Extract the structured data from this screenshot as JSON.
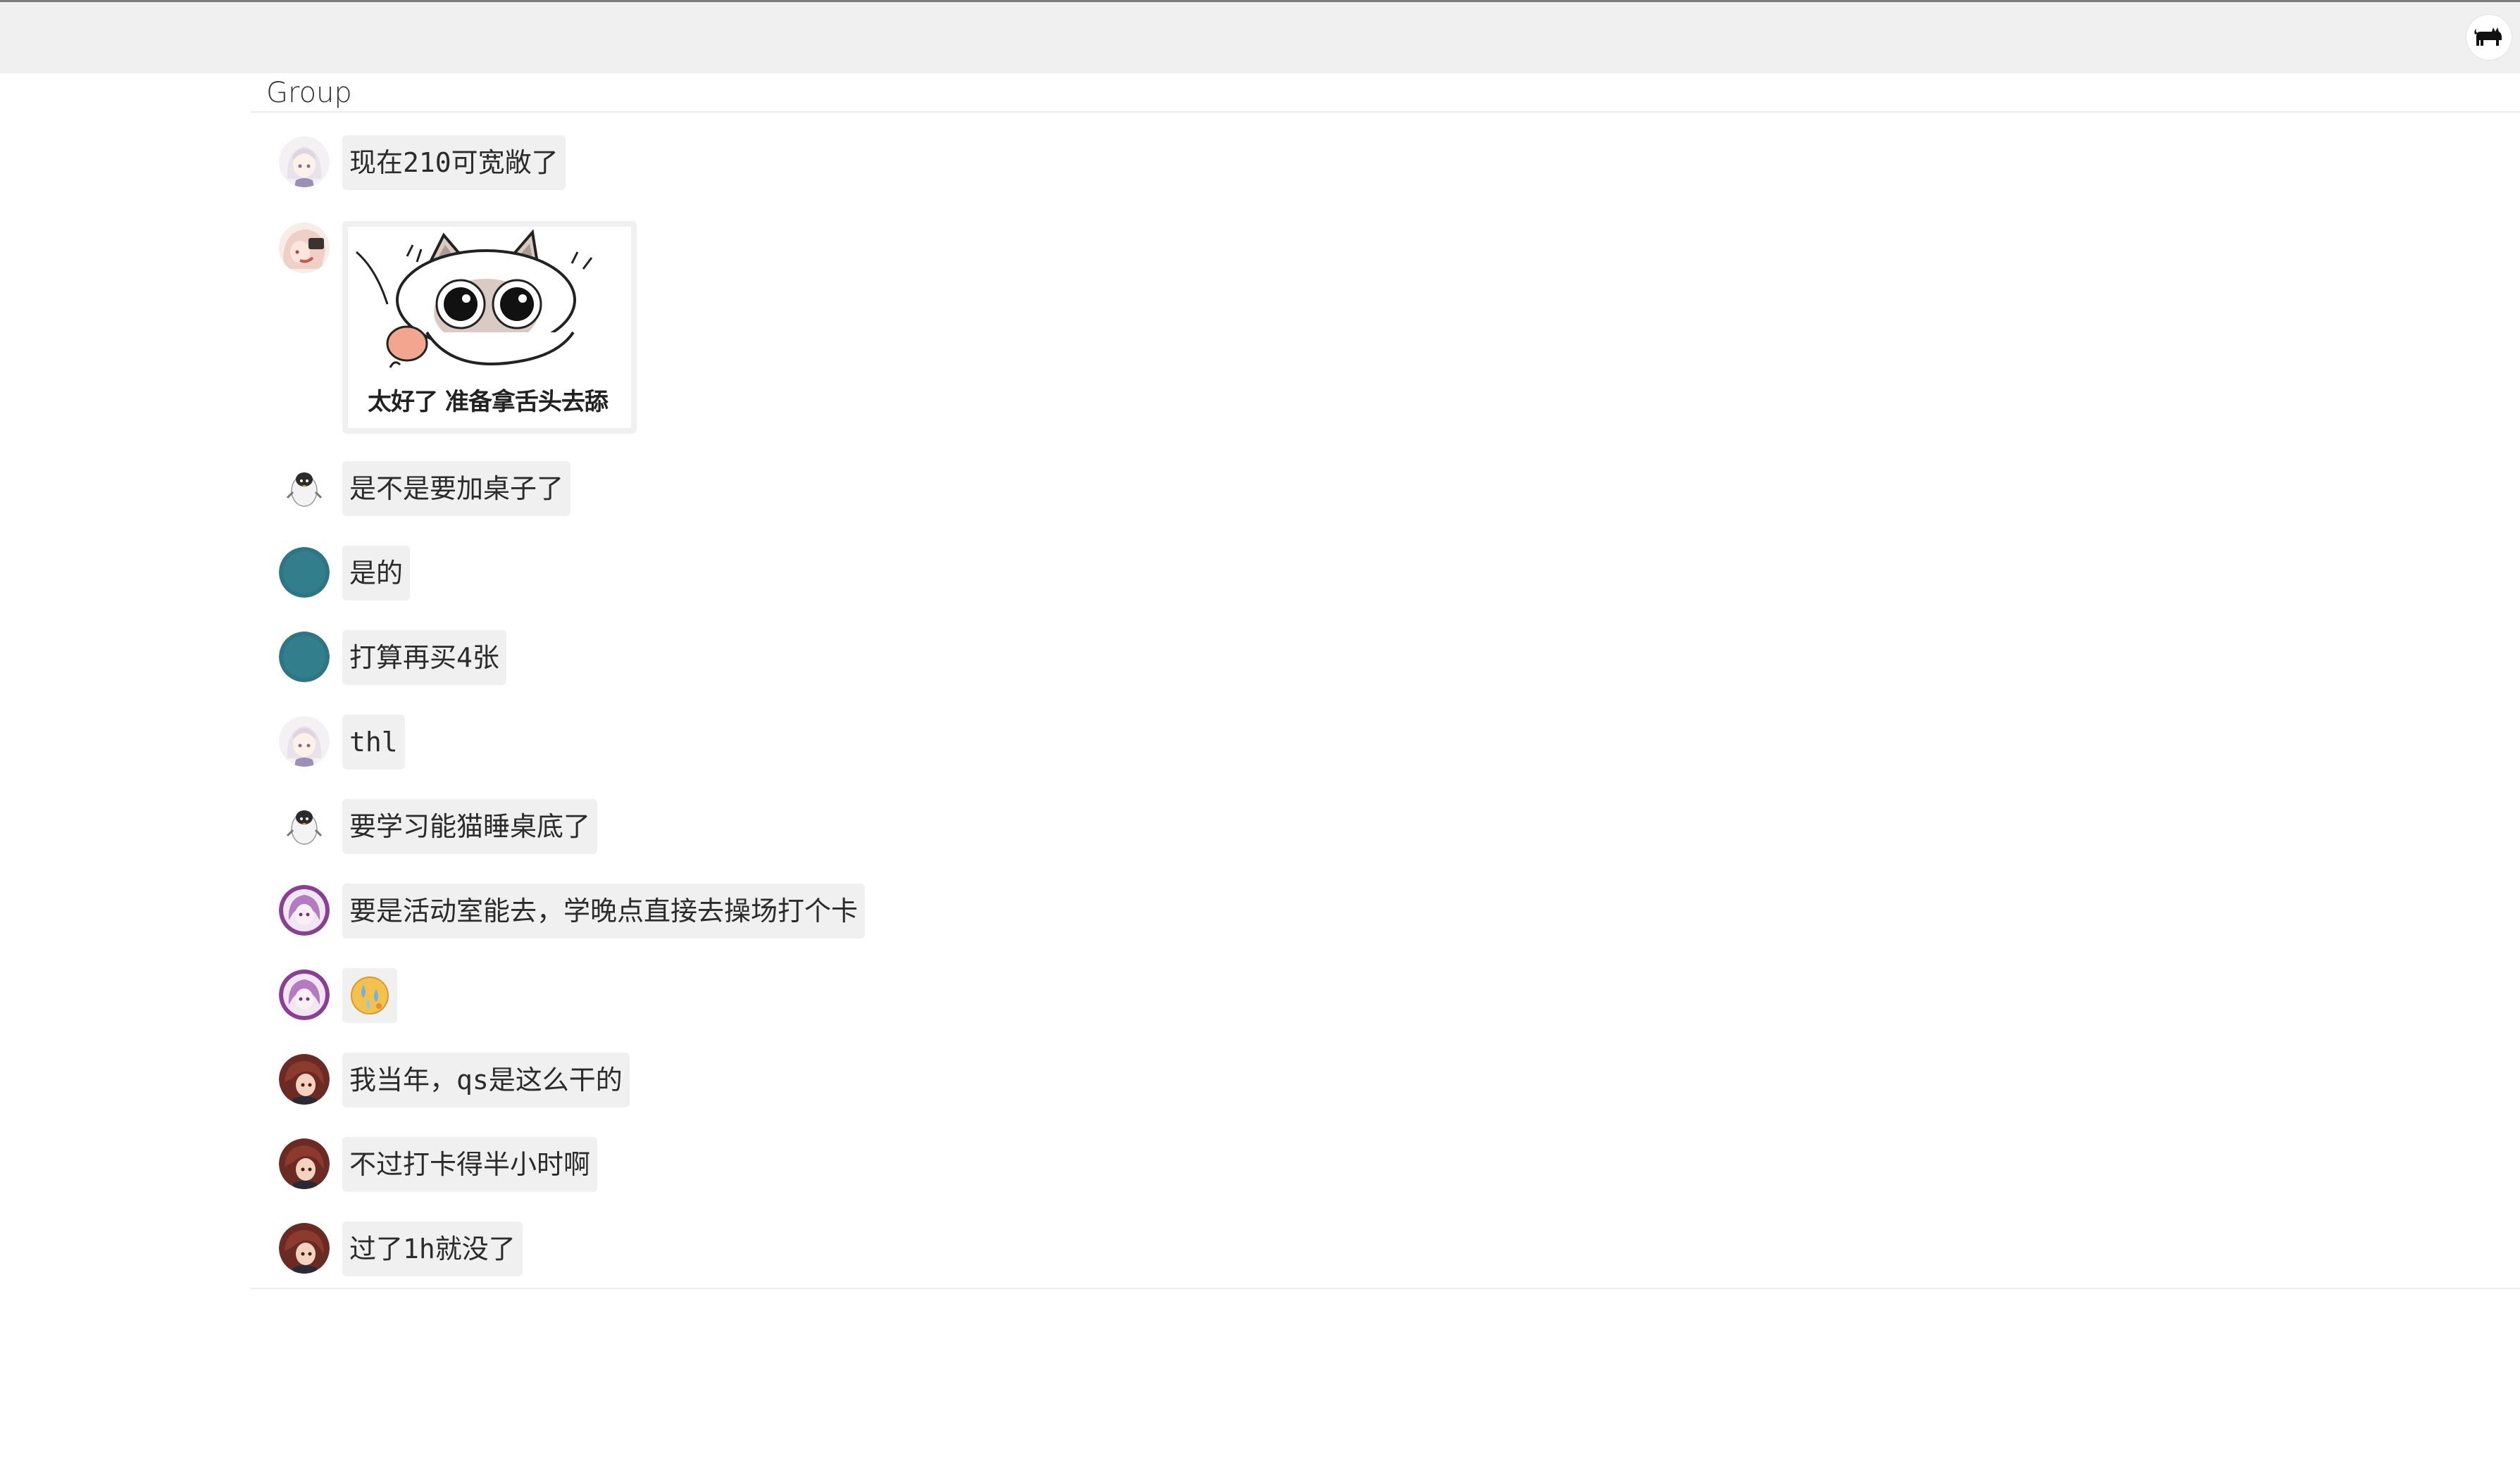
{
  "group": {
    "title": "Group"
  },
  "messages": [
    {
      "avatar": "white-hair-girl-avatar",
      "text": "现在210可宽敞了"
    },
    {
      "avatar": "pink-hair-anime-avatar",
      "sticker_caption": "太好了 准备拿舌头去舔",
      "sticker": "siamese-cat-sticker"
    },
    {
      "avatar": "penguin-avatar",
      "text": "是不是要加桌子了"
    },
    {
      "avatar": "teal-circle-avatar",
      "text": "是的"
    },
    {
      "avatar": "teal-circle-avatar",
      "text": "打算再买4张"
    },
    {
      "avatar": "white-hair-girl-avatar",
      "text": "thl"
    },
    {
      "avatar": "penguin-avatar",
      "text": "要学习能猫睡桌底了"
    },
    {
      "avatar": "purple-hair-avatar",
      "text": "要是活动室能去，学晚点直接去操场打个卡"
    },
    {
      "avatar": "purple-hair-avatar",
      "emoji": "sweat-drop-emoji"
    },
    {
      "avatar": "red-brown-hair-avatar",
      "text": "我当年，qs是这么干的"
    },
    {
      "avatar": "red-brown-hair-avatar",
      "text": "不过打卡得半小时啊"
    },
    {
      "avatar": "red-brown-hair-avatar",
      "text": "过了1h就没了"
    }
  ],
  "colors": {
    "topbar": "#f0f0f0",
    "bubble": "#f0f0f0",
    "teal_avatar": "#2e7684"
  }
}
